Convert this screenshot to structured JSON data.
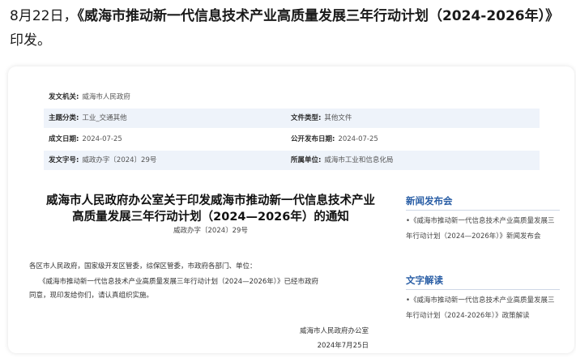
{
  "intro": {
    "prefix": "8月22日，",
    "title": "《威海市推动新一代信息技术产业高质量发展三年行动计划（2024-2026年）》",
    "suffix": "印发。"
  },
  "meta": {
    "issuer_label": "发文机关:",
    "issuer_value": "威海市人民政府",
    "topic_label": "主题分类:",
    "topic_value": "工业_交通其他",
    "doctype_label": "文件类型:",
    "doctype_value": "其他文件",
    "created_label": "成文日期:",
    "created_value": "2024-07-25",
    "published_label": "公开发布日期:",
    "published_value": "2024-07-25",
    "docno_label": "发文字号:",
    "docno_value": "威政办字〔2024〕29号",
    "unit_label": "所属单位:",
    "unit_value": "威海市工业和信息化局"
  },
  "document": {
    "title_line1": "威海市人民政府办公室关于印发威海市推动新一代信息技术产业",
    "title_line2": "高质量发展三年行动计划（2024—2026年）的通知",
    "doc_number": "威政办字〔2024〕29号",
    "salutation": "各区市人民政府，国家级开发区管委，综保区管委，市政府各部门、单位：",
    "body_line1": "《威海市推动新一代信息技术产业高质量发展三年行动计划（2024—2026年）》已经市政府",
    "body_line2": "同意，现印发给你们，请认真组织实施。",
    "signer": "威海市人民政府办公室",
    "sign_date": "2024年7月25日"
  },
  "sidebar": {
    "news_heading": "新闻发布会",
    "news_item": "•《威海市推动新一代信息技术产业高质量发展三年行动计划（2024—2026年）》新闻发布会",
    "interp_heading": "文字解读",
    "interp_item": "•《威海市推动新一代信息技术产业高质量发展三年行动计划（2024-2026年）》政策解读"
  }
}
